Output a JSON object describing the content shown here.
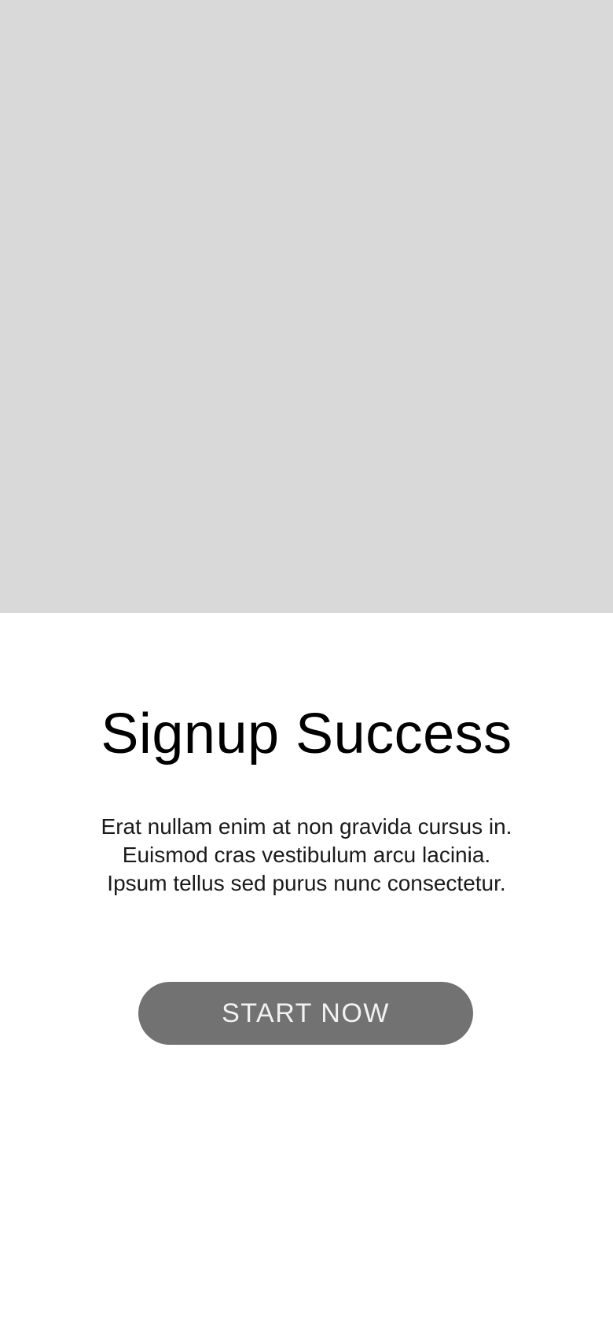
{
  "hero": {
    "image_icon": "image-placeholder",
    "color": "#d9d9d9"
  },
  "content": {
    "title": "Signup Success",
    "body_lines": [
      "Erat nullam enim at non gravida cursus in.",
      "Euismod cras vestibulum arcu lacinia.",
      "Ipsum tellus sed purus nunc consectetur."
    ],
    "cta_label": "START NOW"
  },
  "colors": {
    "button_bg": "#727272",
    "button_text": "#f2f2f2",
    "title_text": "#000000"
  }
}
